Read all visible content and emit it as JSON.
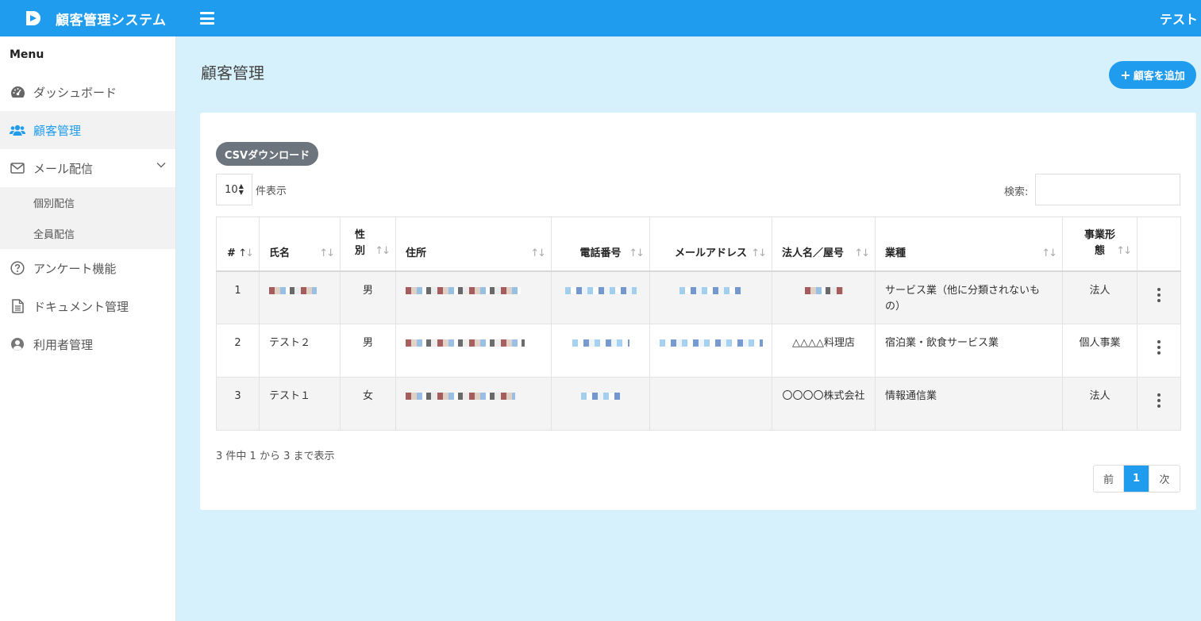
{
  "header": {
    "app_title": "顧客管理システム",
    "user_name": "テスト"
  },
  "sidebar": {
    "menu_title": "Menu",
    "items": [
      {
        "label": "ダッシュボード",
        "icon": "dashboard-icon"
      },
      {
        "label": "顧客管理",
        "icon": "users-icon",
        "active": true
      },
      {
        "label": "メール配信",
        "icon": "envelope-icon",
        "expanded": true
      },
      {
        "label": "アンケート機能",
        "icon": "question-circle-icon"
      },
      {
        "label": "ドキュメント管理",
        "icon": "document-icon"
      },
      {
        "label": "利用者管理",
        "icon": "user-circle-icon"
      }
    ],
    "mail_sub_items": [
      {
        "label": "個別配信"
      },
      {
        "label": "全員配信"
      }
    ]
  },
  "main": {
    "page_title": "顧客管理",
    "add_button_label": "顧客を追加",
    "csv_button_label": "CSVダウンロード",
    "page_length_value": "10",
    "page_length_label": "件表示",
    "search_label": "検索:",
    "search_value": "",
    "table": {
      "columns": [
        {
          "label": "#"
        },
        {
          "label": "氏名"
        },
        {
          "label": "性別"
        },
        {
          "label": "住所"
        },
        {
          "label": "電話番号"
        },
        {
          "label": "メールアドレス"
        },
        {
          "label": "法人名／屋号"
        },
        {
          "label": "業種"
        },
        {
          "label": "事業形態"
        },
        {
          "label": ""
        }
      ],
      "rows": [
        {
          "no": "1",
          "name": "",
          "gender": "男",
          "address": "",
          "phone": "",
          "email": "",
          "company": "",
          "industry": "サービス業（他に分類されないもの）",
          "business_type": "法人"
        },
        {
          "no": "2",
          "name": "テスト２",
          "gender": "男",
          "address": "",
          "phone": "",
          "email": "",
          "company": "△△△△料理店",
          "industry": "宿泊業・飲食サービス業",
          "business_type": "個人事業"
        },
        {
          "no": "3",
          "name": "テスト１",
          "gender": "女",
          "address": "",
          "phone": "",
          "email": "",
          "company": "〇〇〇〇株式会社",
          "industry": "情報通信業",
          "business_type": "法人"
        }
      ]
    },
    "info_text": "3 件中 1 から 3 まで表示",
    "pagination": {
      "prev_label": "前",
      "current_page": "1",
      "next_label": "次"
    }
  },
  "colors": {
    "primary": "#209cee",
    "background": "#d6f1fb",
    "csv_button": "#6c757d"
  }
}
